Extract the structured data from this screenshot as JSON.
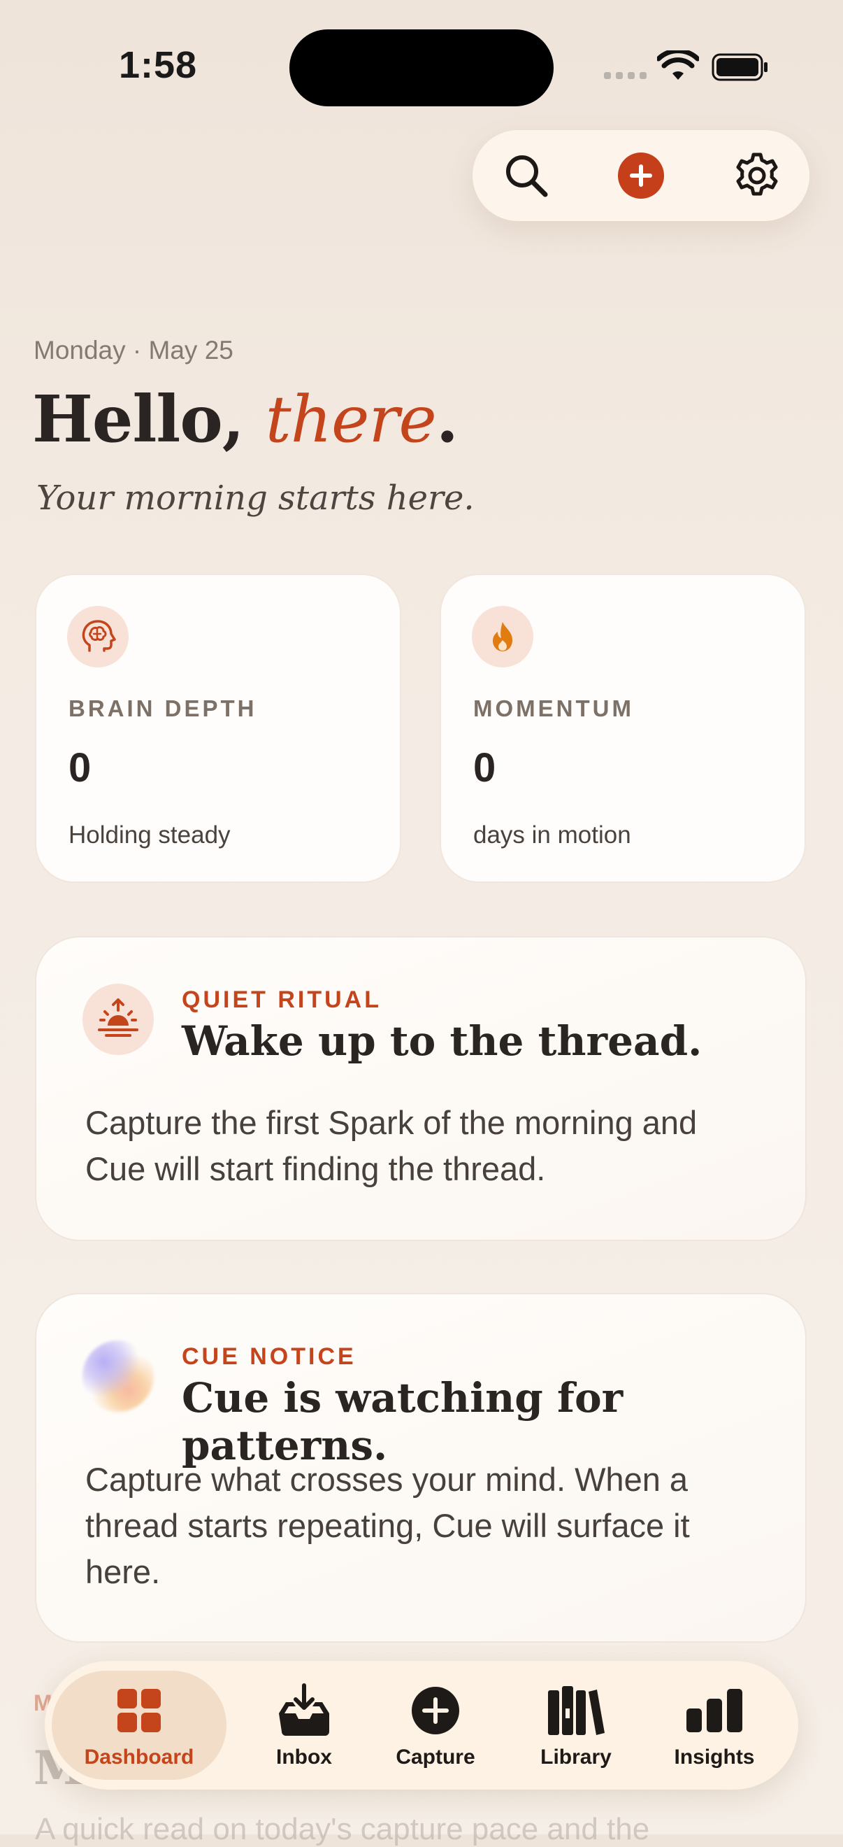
{
  "status_bar": {
    "time": "1:58"
  },
  "toolbar": {
    "icons": [
      "search-icon",
      "plus-icon",
      "gear-icon"
    ],
    "accent": "#c5401a"
  },
  "header": {
    "date": "Monday · May 25",
    "greeting": "Hello, ",
    "greeting_accent": "there",
    "greeting_end": ".",
    "subtitle": "Your morning starts here."
  },
  "stats": [
    {
      "icon": "brain-head-icon",
      "label": "BRAIN DEPTH",
      "value": "0",
      "sub": "Holding steady"
    },
    {
      "icon": "flame-icon",
      "label": "MOMENTUM",
      "value": "0",
      "sub": "days in motion"
    }
  ],
  "cards": {
    "ritual": {
      "icon": "sunrise-icon",
      "kicker": "QUIET RITUAL",
      "title": "Wake up to the thread.",
      "body": "Capture the first Spark of the morning and Cue will start finding the thread."
    },
    "cue": {
      "icon": "cue-orb-icon",
      "kicker": "CUE NOTICE",
      "title": "Cue is watching for patterns.",
      "body": "Capture what crosses your mind. When a thread starts repeating, Cue will surface it here."
    }
  },
  "peek": {
    "kicker": "M",
    "title": "M",
    "body": "A quick read on today's capture pace and the"
  },
  "tabbar": {
    "dashboard": "Dashboard",
    "inbox": "Inbox",
    "capture": "Capture",
    "library": "Library",
    "insights": "Insights",
    "active": "Dashboard",
    "active_color": "#c4441b"
  }
}
